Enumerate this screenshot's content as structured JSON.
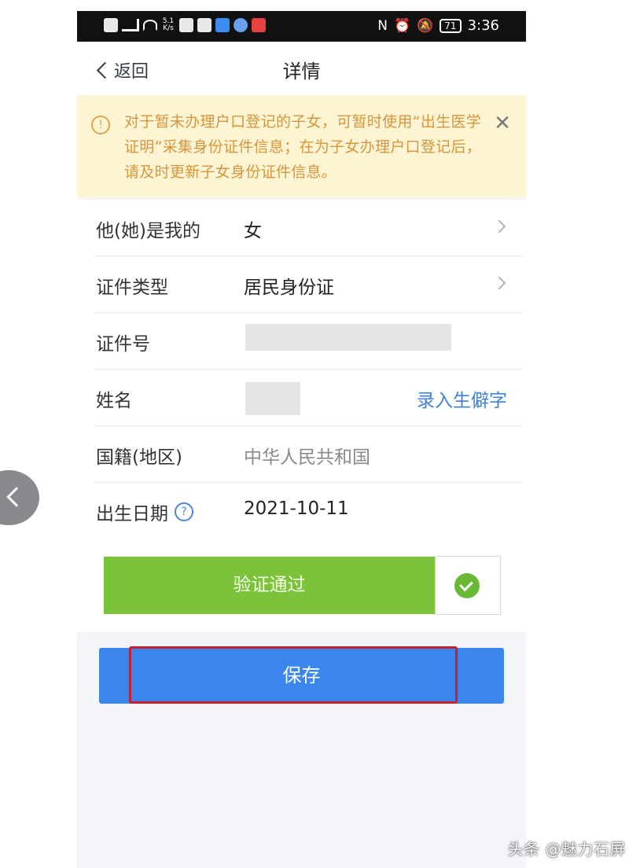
{
  "status_bar": {
    "speed_value": "5.1",
    "speed_unit": "K/s",
    "battery": "71",
    "time": "3:36",
    "icons": [
      "hd-icon",
      "signal-icon",
      "wifi-icon",
      "nfc-icon",
      "alarm-icon",
      "mute-icon"
    ]
  },
  "nav": {
    "back_label": "返回",
    "title": "详情"
  },
  "notice": {
    "text": "对于暂未办理户口登记的子女，可暂时使用“出生医学证明”采集身份证件信息；在为子女办理户口登记后，请及时更新子女身份证件信息。",
    "icon_glyph": "!",
    "close_glyph": "✕",
    "color": "#d8953b",
    "background": "#fdf4d4"
  },
  "form": {
    "relation": {
      "label": "他(她)是我的",
      "value": "女"
    },
    "id_type": {
      "label": "证件类型",
      "value": "居民身份证"
    },
    "id_number": {
      "label": "证件号"
    },
    "name": {
      "label": "姓名",
      "link": "录入生僻字"
    },
    "nationality": {
      "label": "国籍(地区)",
      "value": "中华人民共和国"
    },
    "birth_date": {
      "label": "出生日期",
      "help_glyph": "?",
      "value": "2021-10-11"
    }
  },
  "verify": {
    "label": "验证通过",
    "color": "#7dc23b"
  },
  "save": {
    "label": "保存",
    "color": "#3b86ec",
    "highlight_color": "#c8202f"
  },
  "watermark": {
    "text": "头条 @魅力石屏"
  }
}
